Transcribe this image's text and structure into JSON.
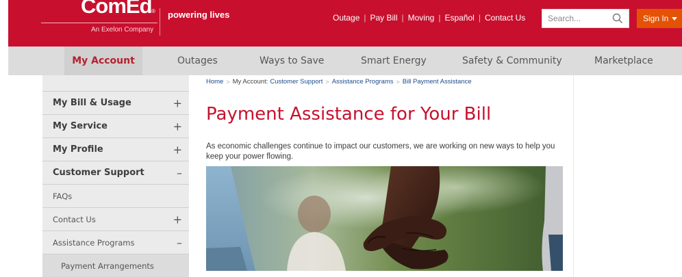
{
  "header": {
    "logo_text": "ComEd",
    "logo_reg": "®",
    "logo_sub": "An Exelon Company",
    "tagline": "powering lives",
    "util_links": [
      "Outage",
      "Pay Bill",
      "Moving",
      "Español",
      "Contact Us"
    ],
    "search_placeholder": "Search...",
    "signin_label": "Sign In",
    "brand_color": "#c8102e",
    "signin_color": "#e35205"
  },
  "nav": {
    "items": [
      "My Account",
      "Outages",
      "Ways to Save",
      "Smart Energy",
      "Safety & Community",
      "Marketplace"
    ],
    "active": "My Account"
  },
  "sidebar": {
    "items": [
      {
        "label": "My Bill & Usage",
        "toggle": "+"
      },
      {
        "label": "My Service",
        "toggle": "+"
      },
      {
        "label": "My Profile",
        "toggle": "+"
      },
      {
        "label": "Customer Support",
        "toggle": "–"
      },
      {
        "label": "FAQs",
        "toggle": ""
      },
      {
        "label": "Contact Us",
        "toggle": "+"
      },
      {
        "label": "Assistance Programs",
        "toggle": "–"
      },
      {
        "label": "Payment Arrangements",
        "toggle": ""
      }
    ]
  },
  "breadcrumb": {
    "items": [
      "Home",
      "My Account",
      "Customer Support",
      "Assistance Programs",
      "Bill Payment Assistance"
    ]
  },
  "content": {
    "title": "Payment Assistance for Your Bill",
    "intro": "As economic challenges continue to impact our customers, we are working on new ways to help you keep your power flowing."
  }
}
